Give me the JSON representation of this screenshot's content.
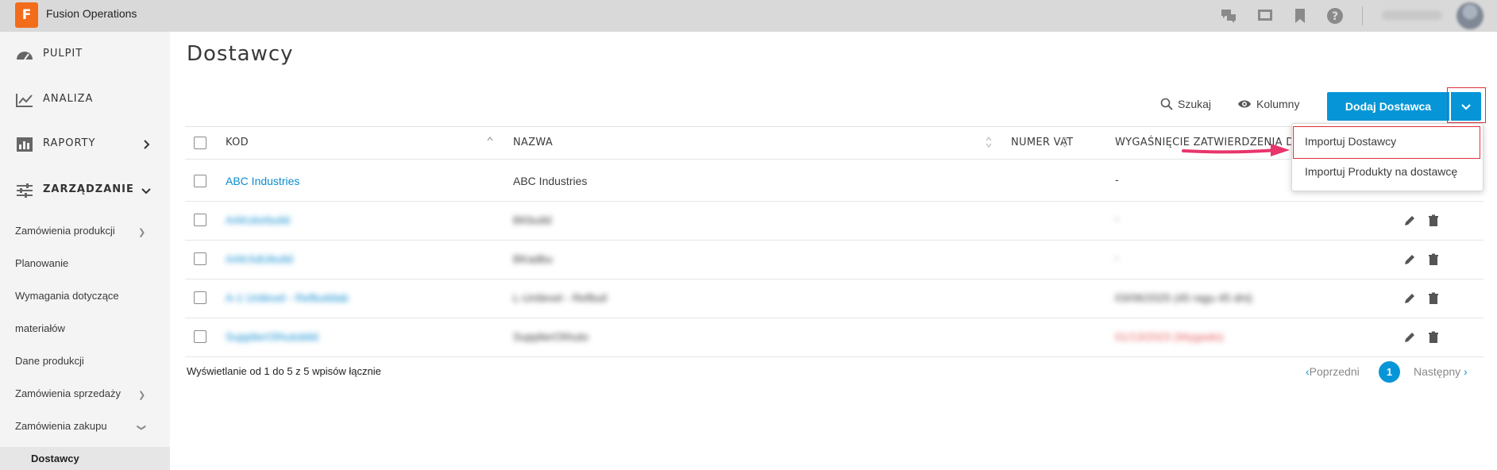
{
  "app": {
    "logo_letter": "F",
    "name": "Fusion Operations"
  },
  "topbar": {
    "icons": [
      "chat-icon",
      "presentation-icon",
      "bookmark-icon",
      "help-icon"
    ]
  },
  "sidebar": {
    "main": [
      {
        "label": "PULPIT",
        "icon": "dashboard-icon"
      },
      {
        "label": "ANALIZA",
        "icon": "analytics-icon"
      },
      {
        "label": "RAPORTY",
        "icon": "reports-icon"
      },
      {
        "label": "ZARZĄDZANIE",
        "icon": "sliders-icon"
      }
    ],
    "sub": [
      "Zamówienia produkcji",
      "Planowanie",
      "Wymagania dotyczące",
      "materiałów",
      "Dane produkcji",
      "Zamówienia sprzedaży",
      "Zamówienia zakupu"
    ],
    "active": "Dostawcy"
  },
  "page": {
    "title": "Dostawcy"
  },
  "toolbar": {
    "search_label": "Szukaj",
    "columns_label": "Kolumny",
    "add_label": "Dodaj Dostawca"
  },
  "table": {
    "headers": [
      "KOD",
      "NAZWA",
      "NUMER VAT",
      "WYGAŚNIĘCIE ZATWIERDZENIA DO"
    ],
    "rows": [
      {
        "code": "ABC Industries",
        "name": "ABC Industries",
        "vat": "",
        "expiry": "-"
      },
      {
        "code": "AAKolorbuild",
        "name": "BKbuild",
        "vat": "",
        "expiry": "-"
      },
      {
        "code": "AAKAdUbuild",
        "name": "BKadbu",
        "vat": "",
        "expiry": "-"
      },
      {
        "code": "A-1 Unilevel - Refbuildab",
        "name": "L-Unilevel - Refbuil",
        "vat": "",
        "expiry": "03/06/2025 (45 ragu 45 dni)"
      },
      {
        "code": "SupplierOfAutobild",
        "name": "SupplierOfAuto",
        "vat": "",
        "expiry": "01/13/2023 (Wygasło)"
      }
    ]
  },
  "dropdown": {
    "items": [
      "Importuj Dostawcy",
      "Importuj Produkty na dostawcę"
    ]
  },
  "footer": {
    "summary": "Wyświetlanie od 1 do 5 z 5 wpisów łącznie",
    "prev": "Poprzedni",
    "next": "Następny",
    "current_page": "1"
  },
  "colors": {
    "accent": "#0696d7",
    "highlight": "#e0303a",
    "arrow": "#e8356b",
    "logo": "#f26c1b"
  }
}
